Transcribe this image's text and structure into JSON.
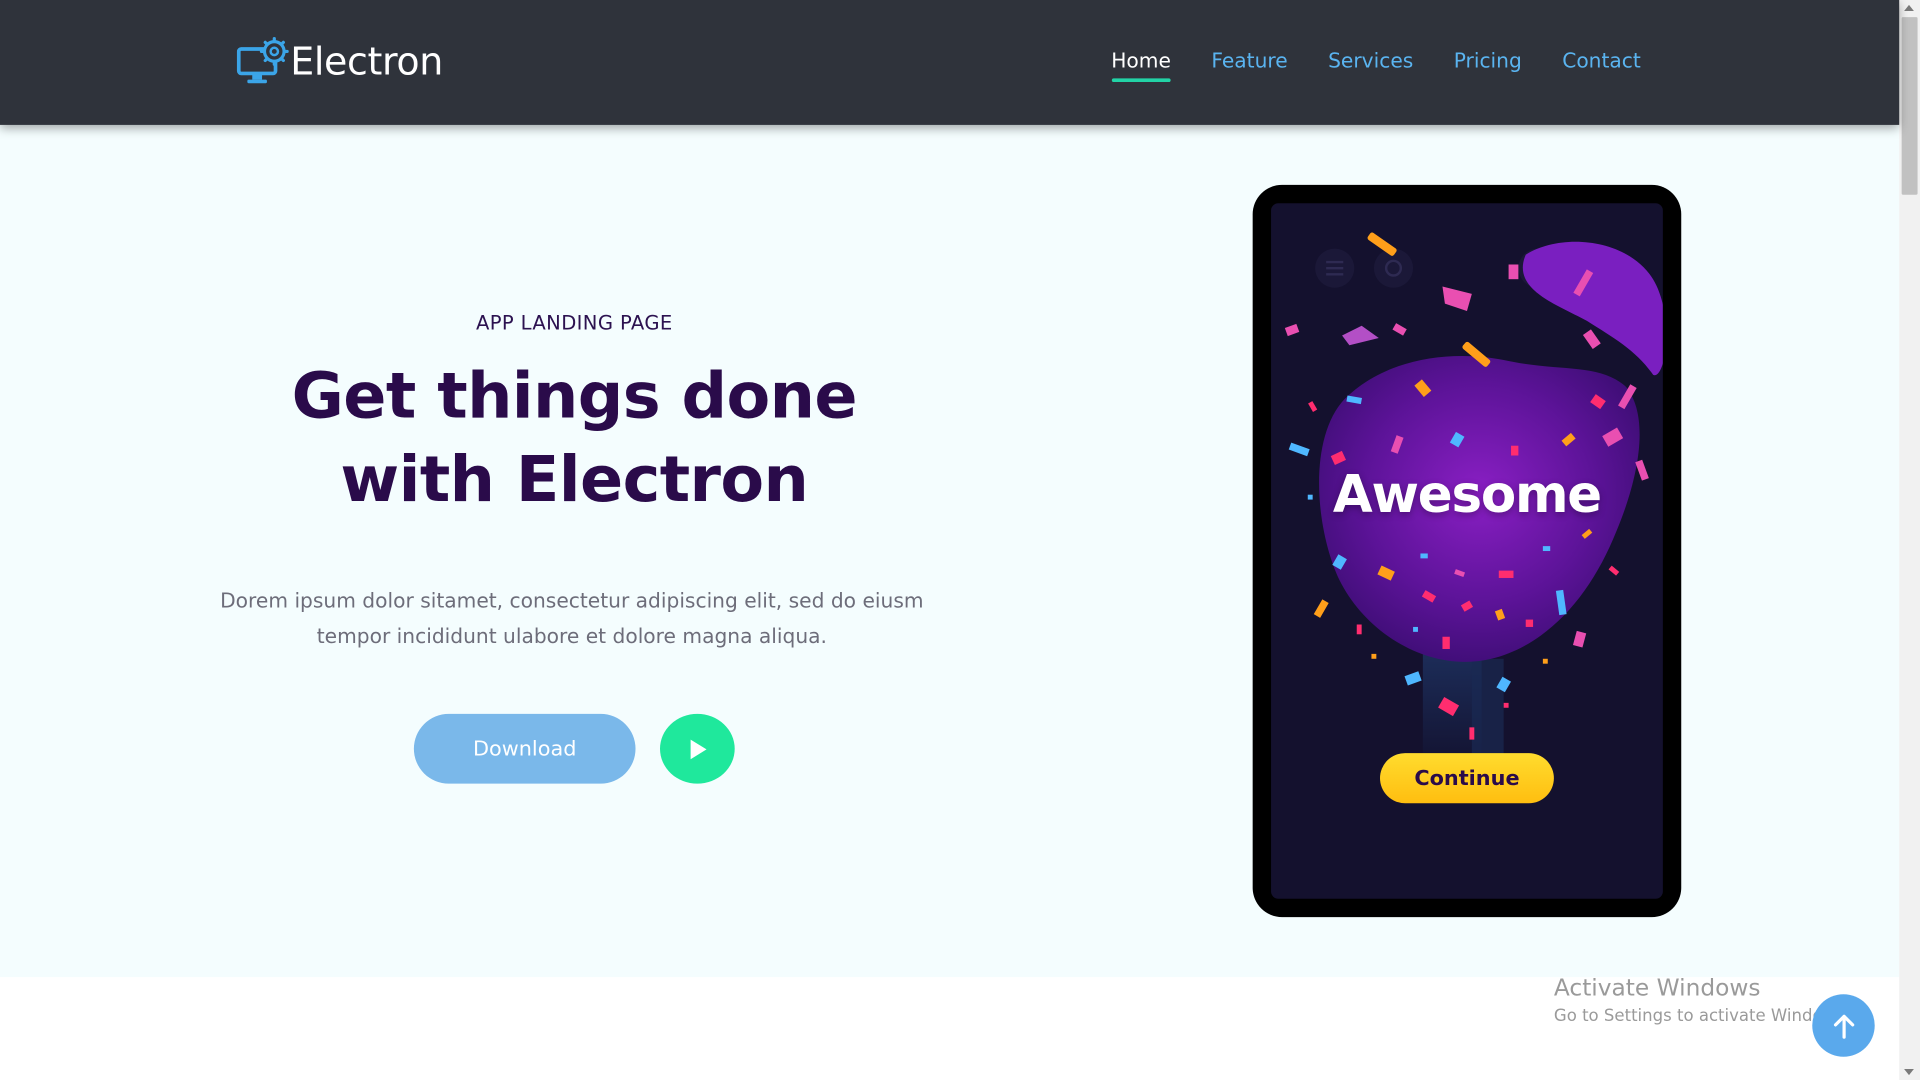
{
  "brand": {
    "name": "Electron",
    "icon": "monitor-gear-icon"
  },
  "nav": {
    "items": [
      {
        "label": "Home",
        "active": true
      },
      {
        "label": "Feature",
        "active": false
      },
      {
        "label": "Services",
        "active": false
      },
      {
        "label": "Pricing",
        "active": false
      },
      {
        "label": "Contact",
        "active": false
      }
    ]
  },
  "hero": {
    "eyebrow": "APP LANDING PAGE",
    "headline_line1": "Get things done",
    "headline_line2": "with Electron",
    "lead_line1": "Dorem ipsum dolor sitamet, consectetur adipiscing elit, sed do eiusm",
    "lead_line2": "tempor incididunt ulabore et dolore magna aliqua.",
    "download_label": "Download",
    "play_icon": "play-icon"
  },
  "phone_screen": {
    "title": "Awesome",
    "continue_label": "Continue"
  },
  "watermark": {
    "title": "Activate Windows",
    "subtitle": "Go to Settings to activate Windows."
  },
  "back_to_top": {
    "icon": "arrow-up-icon"
  },
  "colors": {
    "navbar": "#2f333b",
    "nav_link": "#5ab4f0",
    "nav_active_underline": "#22d3a6",
    "hero_bg": "#f4fdfe",
    "headline": "#2a0b4a",
    "download_button": "#7ab8ea",
    "play_button": "#1fe89c",
    "continue_button": "#ffc61a",
    "back_to_top": "#5aa9ec"
  }
}
